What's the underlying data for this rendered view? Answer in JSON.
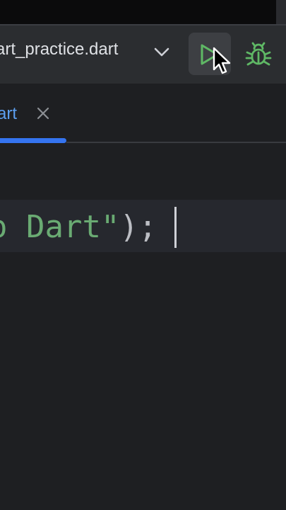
{
  "toolbar": {
    "run_config_label": "art_practice.dart"
  },
  "tab": {
    "label": "art"
  },
  "editor": {
    "code_string": "o Dart\"",
    "code_suffix": ");"
  },
  "colors": {
    "accent": "#3574f0",
    "run_green": "#5fb865",
    "string_green": "#6aab73",
    "tab_text": "#5c9ff0"
  }
}
